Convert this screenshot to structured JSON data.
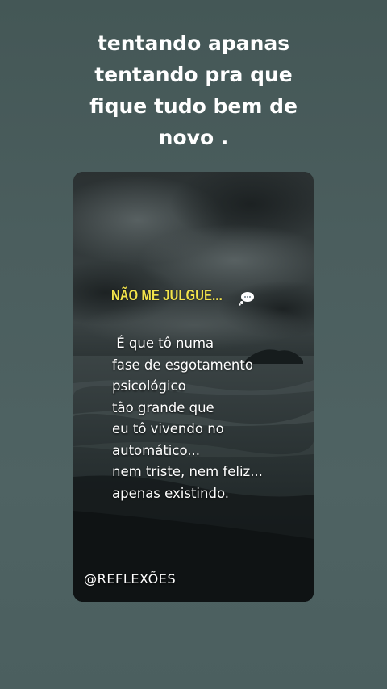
{
  "caption": {
    "lines": [
      "tentando apanas",
      "tentando pra que",
      "fique tudo bem de",
      "novo ."
    ]
  },
  "card": {
    "heading": "NÃO ME JULGUE...",
    "icon": "thought-balloon-icon",
    "body_lines": [
      " É que tô numa",
      "fase de esgotamento",
      "psicológico",
      "tão grande que",
      "eu tô vivendo no",
      "automático...",
      "nem triste, nem feliz...",
      "apenas existindo."
    ],
    "handle": "@REFLEXÕES"
  },
  "colors": {
    "background": "#4b5e5e",
    "heading": "#f2e34b",
    "text": "#ffffff"
  }
}
